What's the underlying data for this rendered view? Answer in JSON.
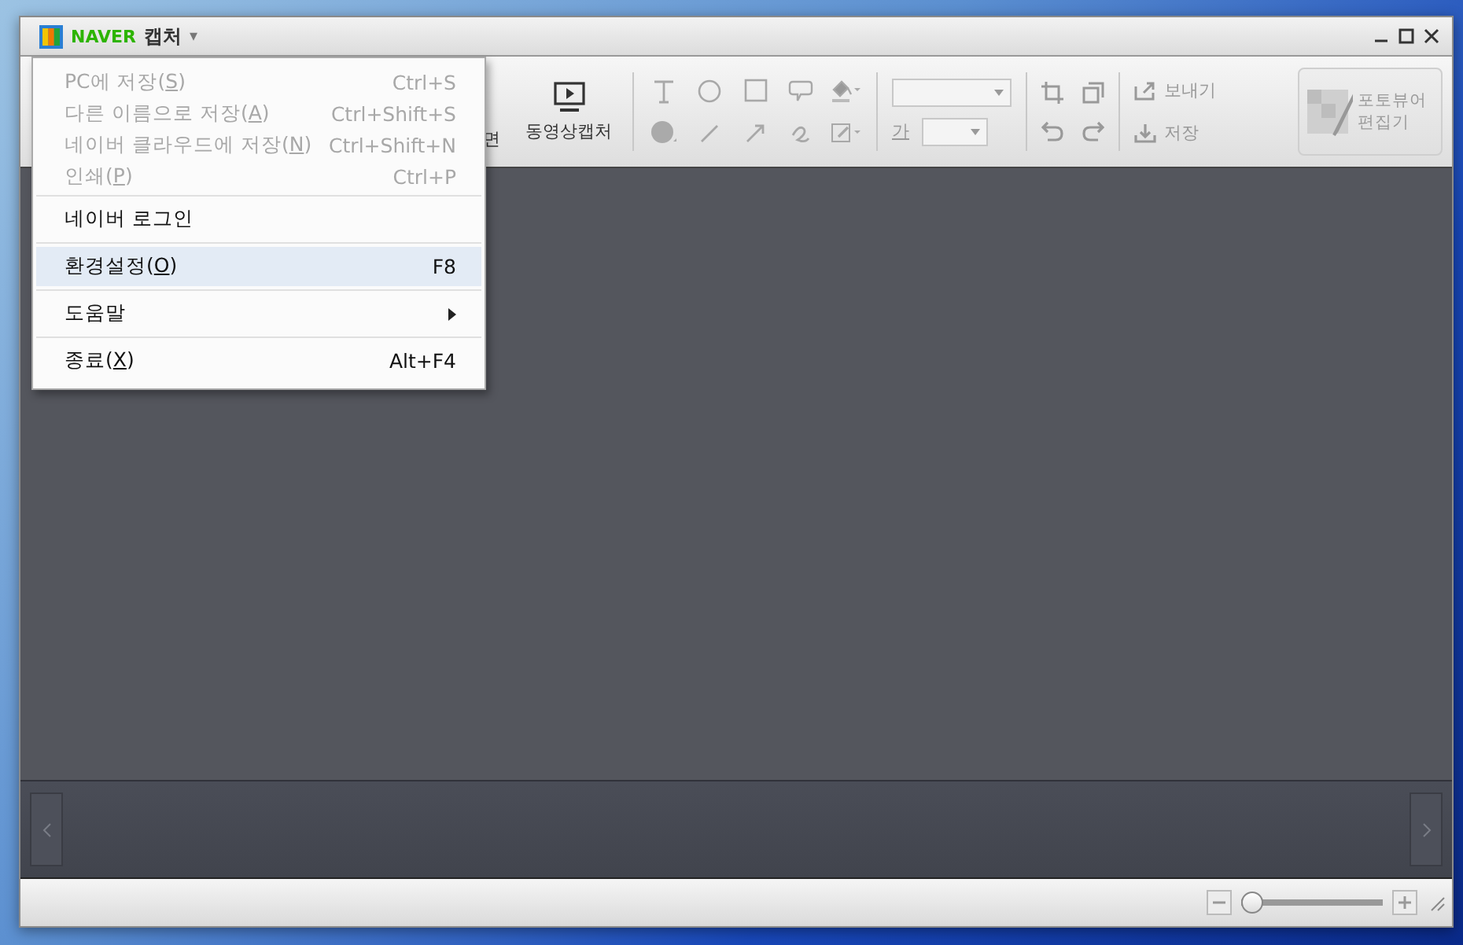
{
  "window": {
    "brand": "NAVER",
    "title": "캡처",
    "caret": "▾"
  },
  "menu": {
    "groups": [
      {
        "items": [
          {
            "kind": "command",
            "before": "PC에 저장(",
            "key": "S",
            "after": ")",
            "shortcut": "Ctrl+S",
            "disabled": true,
            "selected": false
          },
          {
            "kind": "command",
            "before": "다른 이름으로 저장(",
            "key": "A",
            "after": ")",
            "shortcut": "Ctrl+Shift+S",
            "disabled": true,
            "selected": false
          },
          {
            "kind": "command",
            "before": "네이버 클라우드에 저장(",
            "key": "N",
            "after": ")",
            "shortcut": "Ctrl+Shift+N",
            "disabled": true,
            "selected": false
          },
          {
            "kind": "command",
            "before": "인쇄(",
            "key": "P",
            "after": ")",
            "shortcut": "Ctrl+P",
            "disabled": true,
            "selected": false
          }
        ]
      },
      {
        "items": [
          {
            "kind": "command",
            "before": "네이버 로그인",
            "disabled": false,
            "selected": false
          }
        ]
      },
      {
        "items": [
          {
            "kind": "command",
            "before": "환경설정(",
            "key": "O",
            "after": ")",
            "shortcut": "F8",
            "disabled": false,
            "selected": true
          }
        ]
      },
      {
        "items": [
          {
            "kind": "submenu",
            "before": "도움말",
            "disabled": false,
            "selected": false
          }
        ]
      },
      {
        "items": [
          {
            "kind": "command",
            "before": "종료(",
            "key": "X",
            "after": ")",
            "shortcut": "Alt+F4",
            "disabled": false,
            "selected": false
          }
        ]
      }
    ]
  },
  "toolbar": {
    "partial_label": "면",
    "video_capture": "동영상캡처",
    "font_size_label": "가",
    "send": {
      "label": "보내기",
      "disabled": true
    },
    "save": {
      "label": "저장",
      "disabled": true
    },
    "photo_editor": {
      "lines": [
        "포토뷰어",
        "편집기"
      ],
      "disabled": true
    }
  },
  "zoom": {
    "level": 0.0
  }
}
